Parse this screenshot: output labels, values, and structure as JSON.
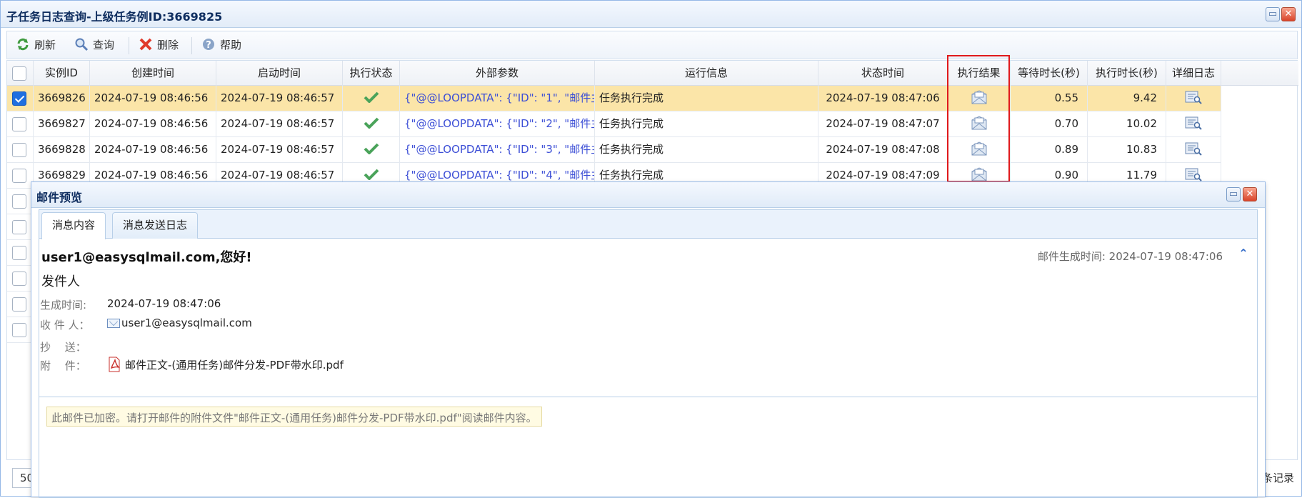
{
  "window": {
    "title": "子任务日志查询-上级任务例ID:3669825",
    "max_icon": "maximize-icon",
    "close_icon": "close-icon"
  },
  "toolbar": {
    "refresh": "刷新",
    "query": "查询",
    "delete": "删除",
    "help": "帮助"
  },
  "grid": {
    "headers": [
      "实例ID",
      "创建时间",
      "启动时间",
      "执行状态",
      "外部参数",
      "运行信息",
      "状态时间",
      "执行结果",
      "等待时长(秒)",
      "执行时长(秒)",
      "详细日志"
    ],
    "rows": [
      {
        "id": "3669826",
        "created": "2024-07-19 08:46:56",
        "started": "2024-07-19 08:46:57",
        "param": "{\"@@LOOPDATA\": {\"ID\": \"1\", \"邮件主",
        "info": "任务执行完成",
        "status_time": "2024-07-19 08:47:06",
        "wait": "0.55",
        "run": "9.42",
        "checked": true
      },
      {
        "id": "3669827",
        "created": "2024-07-19 08:46:56",
        "started": "2024-07-19 08:46:57",
        "param": "{\"@@LOOPDATA\": {\"ID\": \"2\", \"邮件主",
        "info": "任务执行完成",
        "status_time": "2024-07-19 08:47:07",
        "wait": "0.70",
        "run": "10.02",
        "checked": false
      },
      {
        "id": "3669828",
        "created": "2024-07-19 08:46:56",
        "started": "2024-07-19 08:46:57",
        "param": "{\"@@LOOPDATA\": {\"ID\": \"3\", \"邮件主",
        "info": "任务执行完成",
        "status_time": "2024-07-19 08:47:08",
        "wait": "0.89",
        "run": "10.83",
        "checked": false
      },
      {
        "id": "3669829",
        "created": "2024-07-19 08:46:56",
        "started": "2024-07-19 08:46:57",
        "param": "{\"@@LOOPDATA\": {\"ID\": \"4\", \"邮件主",
        "info": "任务执行完成",
        "status_time": "2024-07-19 08:47:09",
        "wait": "0.90",
        "run": "11.79",
        "checked": false
      }
    ],
    "status_icon": "check-icon",
    "result_icon": "mail-icon",
    "log_icon": "log-detail-icon"
  },
  "pager": {
    "page_size": "50",
    "records_tail": "条记录"
  },
  "modal": {
    "title": "邮件预览",
    "tabs": [
      "消息内容",
      "消息发送日志"
    ],
    "greeting": "user1@easysqlmail.com,您好!",
    "generated_right": "邮件生成时间: 2024-07-19 08:47:06",
    "sender_heading": "发件人",
    "fields": {
      "gen_label": "生成时间:",
      "gen_value": "2024-07-19 08:47:06",
      "to_label": "收 件 人：",
      "to_value": "user1@easysqlmail.com",
      "cc_label": "抄　 送：",
      "cc_value": "",
      "att_label": "附　 件：",
      "att_value": "邮件正文-(通用任务)邮件分发-PDF带水印.pdf"
    },
    "notice": "此邮件已加密。请打开邮件的附件文件\"邮件正文-(通用任务)邮件分发-PDF带水印.pdf\"阅读邮件内容。"
  },
  "colors": {
    "selected_row": "#fbe5a8",
    "highlight_border": "#e0191c",
    "accent": "#1f6fe0"
  }
}
